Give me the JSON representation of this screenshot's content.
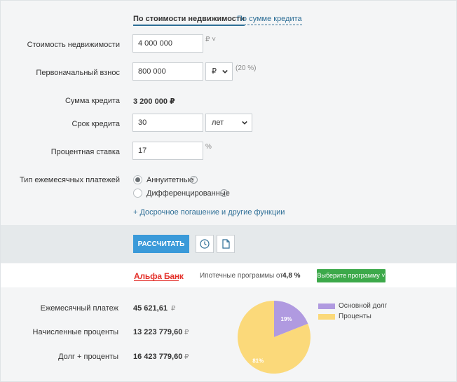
{
  "tabs": {
    "by_property": "По стоимости недвижимости",
    "by_credit": "По сумме кредита"
  },
  "form": {
    "property_cost": {
      "label": "Стоимость недвижимости",
      "value": "4 000 000",
      "unit": "₽ ˅"
    },
    "down_payment": {
      "label": "Первоначальный взнос",
      "value": "800 000",
      "currency": "₽",
      "percent": "(20 %)"
    },
    "loan_amount": {
      "label": "Сумма кредита",
      "value": "3 200 000 ₽"
    },
    "term": {
      "label": "Срок кредита",
      "value": "30",
      "unit": "лет"
    },
    "rate": {
      "label": "Процентная ставка",
      "value": "17",
      "unit": "%"
    },
    "payment_type": {
      "label": "Тип ежемесячных платежей",
      "options": [
        "Аннуитетные",
        "Дифференцированные"
      ],
      "selected": "Аннуитетные"
    },
    "more_link": "+ Досрочное погашение и другие функции"
  },
  "actions": {
    "calculate": "РАССЧИТАТЬ"
  },
  "bank": {
    "name": "Альфа Банк",
    "text": "Ипотечные программы от",
    "rate": "4,8 %",
    "button": "Выберите программу ˅"
  },
  "results": {
    "monthly": {
      "label": "Ежемесячный платеж",
      "value": "45 621,61",
      "currency": "₽"
    },
    "interest": {
      "label": "Начисленные проценты",
      "value": "13 223 779,60",
      "currency": "₽"
    },
    "total": {
      "label": "Долг + проценты",
      "value": "16 423 779,60",
      "currency": "₽"
    }
  },
  "chart_data": {
    "type": "pie",
    "slices": [
      {
        "name": "Основной долг",
        "value": 19,
        "label": "19%",
        "color": "#b09ae0"
      },
      {
        "name": "Проценты",
        "value": 81,
        "label": "81%",
        "color": "#fbd97a"
      }
    ]
  },
  "colors": {
    "accent": "#3a9ad9",
    "green": "#3ca94a",
    "bank_red": "#e4312b",
    "link": "#2d6e96"
  }
}
